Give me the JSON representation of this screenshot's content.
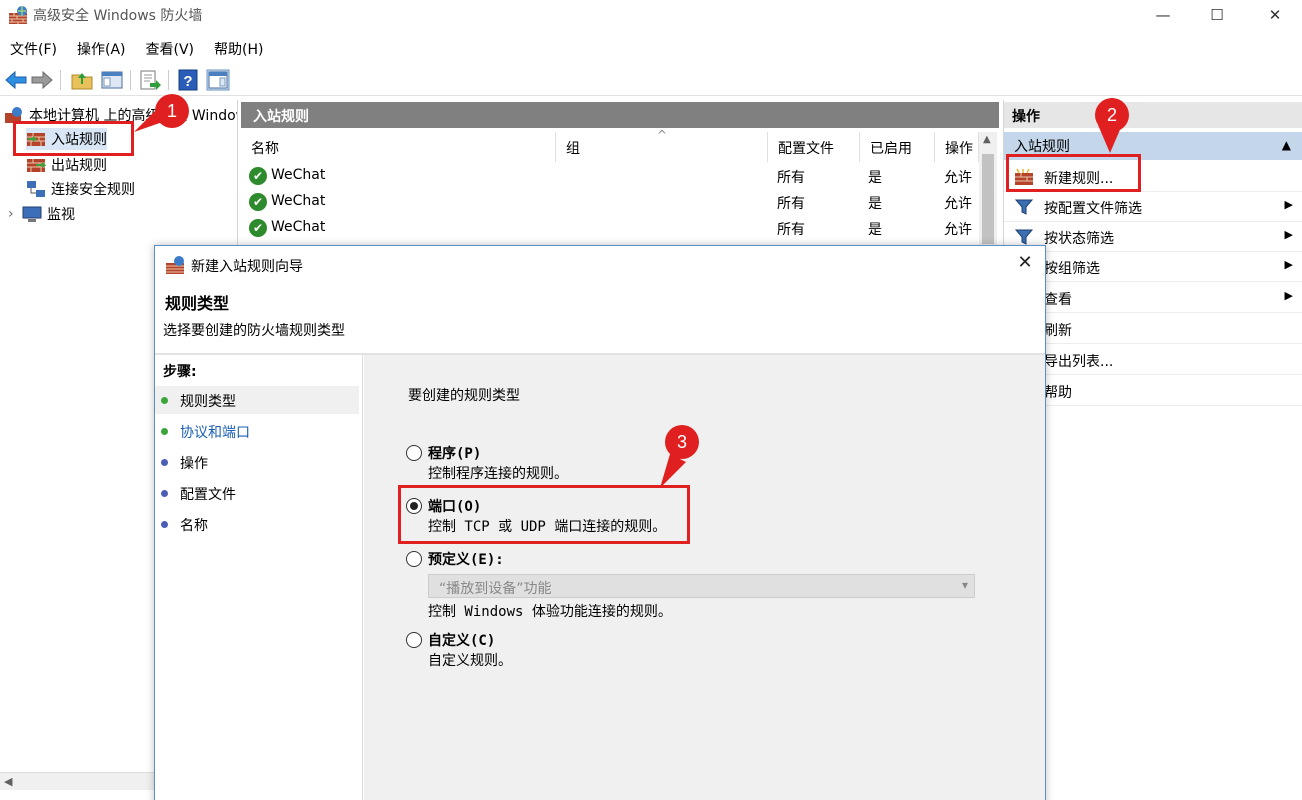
{
  "window": {
    "title": "高级安全 Windows 防火墙",
    "minimize": "—",
    "maximize": "☐",
    "close": "✕"
  },
  "menu": [
    "文件(F)",
    "操作(A)",
    "查看(V)",
    "帮助(H)"
  ],
  "tree": {
    "root": "本地计算机 上的高级安全 Windows 防火墙",
    "items": [
      "入站规则",
      "出站规则",
      "连接安全规则",
      "监视"
    ],
    "expander": "›"
  },
  "rules_panel": {
    "header": "入站规则",
    "columns": [
      "名称",
      "组",
      "配置文件",
      "已启用",
      "操作"
    ],
    "rows": [
      {
        "name": "WeChat",
        "profile": "所有",
        "enabled": "是",
        "action": "允许"
      },
      {
        "name": "WeChat",
        "profile": "所有",
        "enabled": "是",
        "action": "允许"
      },
      {
        "name": "WeChat",
        "profile": "所有",
        "enabled": "是",
        "action": "允许"
      }
    ]
  },
  "actions_panel": {
    "header": "操作",
    "section": "入站规则",
    "items": [
      {
        "label": "新建规则...",
        "has_submenu": false
      },
      {
        "label": "按配置文件筛选",
        "has_submenu": true
      },
      {
        "label": "按状态筛选",
        "has_submenu": true
      },
      {
        "label": "按组筛选",
        "has_submenu": true
      },
      {
        "label": "查看",
        "has_submenu": true
      },
      {
        "label": "刷新",
        "has_submenu": false
      },
      {
        "label": "导出列表...",
        "has_submenu": false
      },
      {
        "label": "帮助",
        "has_submenu": false
      }
    ]
  },
  "dialog": {
    "title": "新建入站规则向导",
    "heading": "规则类型",
    "subheading": "选择要创建的防火墙规则类型",
    "steps_title": "步骤:",
    "steps": [
      "规则类型",
      "协议和端口",
      "操作",
      "配置文件",
      "名称"
    ],
    "prompt": "要创建的规则类型",
    "options": [
      {
        "label": "程序(P)",
        "desc": "控制程序连接的规则。",
        "selected": false
      },
      {
        "label": "端口(O)",
        "desc": "控制 TCP 或 UDP 端口连接的规则。",
        "selected": true
      },
      {
        "label": "预定义(E):",
        "desc": "控制 Windows 体验功能连接的规则。",
        "selected": false
      },
      {
        "label": "自定义(C)",
        "desc": "自定义规则。",
        "selected": false
      }
    ],
    "predefined_value": "“播放到设备”功能"
  },
  "annotations": [
    "1",
    "2",
    "3"
  ],
  "colors": {
    "annotation_red": "#e02020",
    "header_gray": "#808080",
    "actions_section_blue": "#c4d6ea",
    "step_done_green": "#3aa63a",
    "step_pending_blue": "#4a5fb5",
    "link_blue": "#1a5fb4"
  }
}
